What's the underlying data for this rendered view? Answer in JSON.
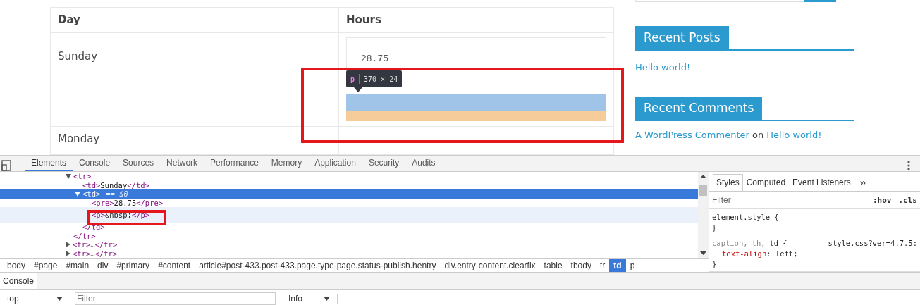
{
  "page": {
    "search": {
      "kind": "cut"
    },
    "table": {
      "columns": [
        "Day",
        "Hours"
      ],
      "rows": [
        {
          "day": "Sunday",
          "pre": "28.75",
          "highlighted": true
        },
        {
          "day": "Monday"
        }
      ]
    },
    "inspect_tooltip": {
      "tag": "p",
      "size": "370 × 24"
    },
    "sidebar": [
      {
        "title": "Recent Posts",
        "items": [
          {
            "kind": "post",
            "link": "Hello world!"
          }
        ]
      },
      {
        "title": "Recent Comments",
        "items": [
          {
            "kind": "comment",
            "author": "A WordPress Commenter",
            "joiner": "on",
            "link": "Hello world!"
          }
        ]
      }
    ]
  },
  "devtools": {
    "tabs": [
      {
        "label": "Elements",
        "selected": true
      },
      {
        "label": "Console",
        "selected": false
      },
      {
        "label": "Sources",
        "selected": false
      },
      {
        "label": "Network",
        "selected": false
      },
      {
        "label": "Performance",
        "selected": false
      },
      {
        "label": "Memory",
        "selected": false
      },
      {
        "label": "Application",
        "selected": false
      },
      {
        "label": "Security",
        "selected": false
      },
      {
        "label": "Audits",
        "selected": false
      }
    ],
    "dom_tree": [
      {
        "open": "<tr>",
        "close": "</tr>",
        "expanded": true,
        "children": [
          {
            "text": "<td>Sunday</td>"
          },
          {
            "open": "<td>",
            "suffix": "== $0",
            "close": "</td>",
            "expanded": true,
            "selected": true,
            "children": [
              {
                "text": "<pre>28.75</pre>"
              },
              {
                "text": "<p>&nbsp;</p>",
                "hovered": true
              }
            ]
          }
        ]
      },
      {
        "text": "<tr>…</tr>",
        "expanded": false
      },
      {
        "text": "<tr>…</tr>",
        "expanded": false
      }
    ],
    "breadcrumbs": [
      {
        "label": "body",
        "selected": false
      },
      {
        "label": "#page",
        "selected": false
      },
      {
        "label": "#main",
        "selected": false
      },
      {
        "label": "div",
        "selected": false
      },
      {
        "label": "#primary",
        "selected": false
      },
      {
        "label": "#content",
        "selected": false
      },
      {
        "label": "article#post-433.post-433.page.type-page.status-publish.hentry",
        "selected": false
      },
      {
        "label": "div.entry-content.clearfix",
        "selected": false
      },
      {
        "label": "table",
        "selected": false
      },
      {
        "label": "tbody",
        "selected": false
      },
      {
        "label": "tr",
        "selected": false
      },
      {
        "label": "td",
        "selected": true
      },
      {
        "label": "p",
        "selected": false
      }
    ],
    "styles": {
      "tabs": [
        {
          "label": "Styles",
          "selected": true
        },
        {
          "label": "Computed",
          "selected": false
        },
        {
          "label": "Event Listeners",
          "selected": false
        }
      ],
      "more": "»",
      "filter": {
        "placeholder": "Filter"
      },
      "hov": ":hov",
      "cls": ".cls",
      "rules": [
        {
          "selectors": [
            {
              "text": "element.style",
              "matched": true
            }
          ],
          "open": "{",
          "close": "}"
        },
        {
          "selectors": [
            {
              "text": "caption,",
              "matched": false
            },
            {
              "text": "th,",
              "matched": false
            },
            {
              "text": "td",
              "matched": true
            }
          ],
          "open": "{",
          "close": "}",
          "source": "style.css?ver=4.7.5:",
          "declarations": [
            {
              "property": "text-align",
              "separator": ":",
              "value": "left;"
            }
          ]
        }
      ]
    },
    "drawer": {
      "tabs": [
        {
          "label": "Console",
          "selected": true
        }
      ],
      "context": "top",
      "filter": {
        "placeholder": "Filter"
      },
      "level": "Info"
    }
  }
}
